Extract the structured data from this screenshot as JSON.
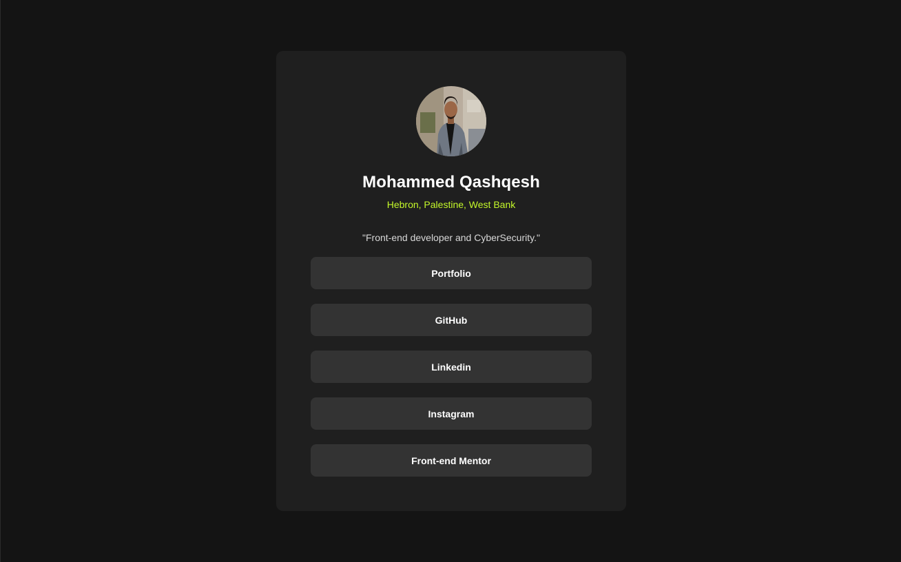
{
  "profile": {
    "name": "Mohammed Qashqesh",
    "location": "Hebron, Palestine, West Bank",
    "bio": "\"Front-end developer and CyberSecurity.\""
  },
  "links": [
    {
      "label": "Portfolio"
    },
    {
      "label": "GitHub"
    },
    {
      "label": "Linkedin"
    },
    {
      "label": "Instagram"
    },
    {
      "label": "Front-end Mentor"
    }
  ],
  "colors": {
    "page_background": "#141414",
    "card_background": "#1f1f1f",
    "button_background": "#333333",
    "accent": "#c4f82a",
    "text": "#ffffff"
  },
  "icons": {
    "avatar": "profile-photo"
  }
}
